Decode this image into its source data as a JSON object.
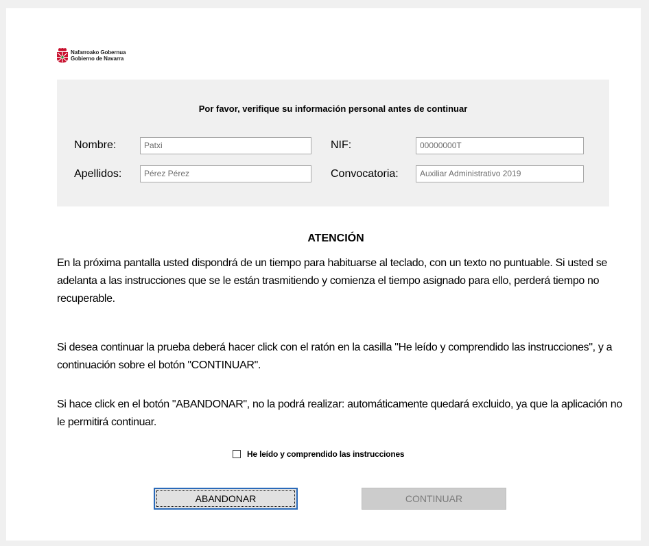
{
  "logo": {
    "line1": "Nafarroako Gobernua",
    "line2": "Gobierno de Navarra",
    "icon": "navarra-coat-of-arms-icon",
    "color": "#c8102e"
  },
  "info": {
    "heading": "Por favor, verifique su información personal antes de continuar",
    "nombre_label": "Nombre:",
    "nombre_value": "Patxi",
    "apellidos_label": "Apellidos:",
    "apellidos_value": "Pérez Pérez",
    "nif_label": "NIF:",
    "nif_value": "00000000T",
    "convocatoria_label": "Convocatoria:",
    "convocatoria_value": "Auxiliar Administrativo 2019"
  },
  "attention": {
    "title": "ATENCIÓN",
    "para1": "En la próxima pantalla usted dispondrá de un tiempo para habituarse al teclado, con un texto no puntuable. Si usted se adelanta a las instrucciones que se le están trasmitiendo y comienza el tiempo asignado para ello, perderá tiempo no recuperable.",
    "para2": "Si desea continuar la prueba deberá hacer click con el ratón en la casilla \"He leído y comprendido las instrucciones\", y a continuación sobre el botón \"CONTINUAR\".",
    "para3": "Si hace click en el botón \"ABANDONAR\", no la podrá realizar: automáticamente quedará excluido, ya que la aplicación no le permitirá continuar."
  },
  "confirm": {
    "checkbox_label": "He leído y comprendido las instrucciones",
    "checked": false
  },
  "buttons": {
    "abandon": "ABANDONAR",
    "continue": "CONTINUAR",
    "continue_enabled": false
  }
}
